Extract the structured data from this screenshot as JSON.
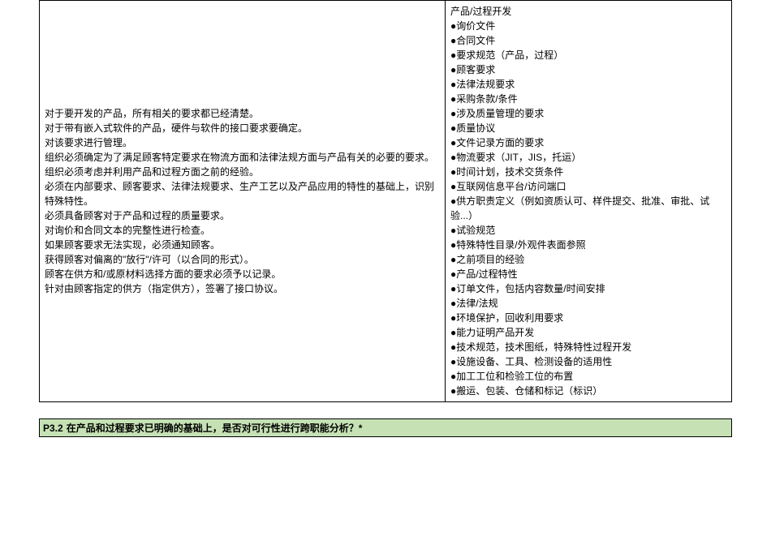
{
  "left": {
    "p1": "对于要开发的产品，所有相关的要求都已经清楚。",
    "p2": "对于带有嵌入式软件的产品，硬件与软件的接口要求要确定。",
    "p3": "对该要求进行管理。",
    "p4": "组织必须确定为了满足顾客特定要求在物流方面和法律法规方面与产品有关的必要的要求。",
    "p5": "组织必须考虑并利用产品和过程方面之前的经验。",
    "p6": "必须在内部要求、顾客要求、法律法规要求、生产工艺以及产品应用的特性的基础上，识别特殊特性。",
    "p7": "必须具备顾客对于产品和过程的质量要求。",
    "p8": "对询价和合同文本的完整性进行检查。",
    "p9": "如果顾客要求无法实现，必须通知顾客。",
    "p10": "获得顾客对偏离的\"放行\"/许可（以合同的形式）。",
    "p11": "顾客在供方和/或原材料选择方面的要求必须予以记录。",
    "p12": "针对由顾客指定的供方（指定供方），签署了接口协议。"
  },
  "right": {
    "title": "产品/过程开发",
    "b1": "●询价文件",
    "b2": "●合同文件",
    "b3": "●要求规范（产品，过程）",
    "b4": "●顾客要求",
    "b5": "●法律法规要求",
    "b6": "●采购条款/条件",
    "b7": "●涉及质量管理的要求",
    "b8": "●质量协议",
    "b9": "●文件记录方面的要求",
    "b10": "●物流要求（JIT，JIS，托运）",
    "b11": "●时间计划，技术交货条件",
    "b12": "●互联网信息平台/访问端口",
    "b13": "●供方职责定义（例如资质认可、样件提交、批准、审批、试验...）",
    "b14": "●试验规范",
    "b15": "●特殊特性目录/外观件表面参照",
    "b16": "●之前项目的经验",
    "b17": "●产品/过程特性",
    "b18": "●订单文件，包括内容数量/时间安排",
    "b19": "●法律/法规",
    "b20": "●环境保护，回收利用要求",
    "b21": "●能力证明产品开发",
    "b22": "●技术规范，技术图纸，特殊特性过程开发",
    "b23": "●设施设备、工具、检测设备的适用性",
    "b24": "●加工工位和检验工位的布置",
    "b25": "●搬运、包装、仓储和标记（标识）"
  },
  "section": {
    "code": "P3.2",
    "text": "在产品和过程要求已明确的基础上，是否对可行性进行跨职能分析？*"
  }
}
